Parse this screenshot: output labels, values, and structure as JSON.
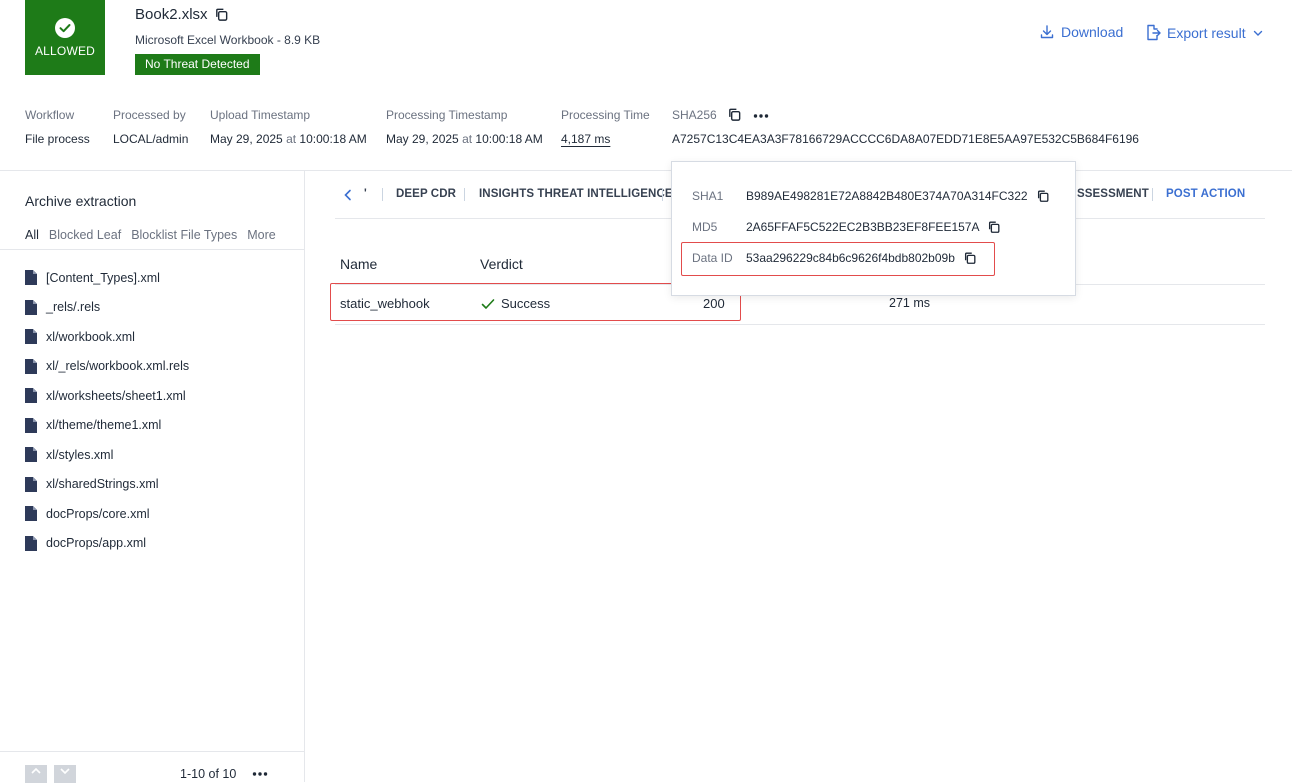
{
  "header": {
    "status_label": "ALLOWED",
    "file_name": "Book2.xlsx",
    "file_subtitle": "Microsoft Excel Workbook - 8.9 KB",
    "threat_badge": "No Threat Detected",
    "download_label": "Download",
    "export_label": "Export result",
    "accent_color": "#1e7b18",
    "link_color": "#3b6fd1"
  },
  "meta": {
    "workflow_label": "Workflow",
    "workflow_value": "File process",
    "processed_by_label": "Processed by",
    "processed_by_value": "LOCAL/admin",
    "upload_label": "Upload Timestamp",
    "upload_date": "May 29, 2025",
    "upload_at": "at",
    "upload_time": "10:00:18 AM",
    "processing_ts_label": "Processing Timestamp",
    "processing_date": "May 29, 2025",
    "processing_at": "at",
    "processing_time_of_day": "10:00:18 AM",
    "processing_time_label": "Processing Time",
    "processing_time_value": "4,187 ms",
    "sha256_label": "SHA256",
    "sha256_value": "A7257C13C4EA3A3F78166729ACCCC6DA8A07EDD71E8E5AA97E532C5B684F6196"
  },
  "sidebar": {
    "title": "Archive extraction",
    "tabs": [
      "All",
      "Blocked Leaf",
      "Blocklist File Types",
      "More"
    ],
    "files": [
      "[Content_Types].xml",
      "_rels/.rels",
      "xl/workbook.xml",
      "xl/_rels/workbook.xml.rels",
      "xl/worksheets/sheet1.xml",
      "xl/theme/theme1.xml",
      "xl/styles.xml",
      "xl/sharedStrings.xml",
      "docProps/core.xml",
      "docProps/app.xml"
    ],
    "pagination": "1-10 of 10"
  },
  "tabs": {
    "prev_indicator": "'",
    "deep_cdr": "DEEP CDR",
    "insights": "INSIGHTS THREAT INTELLIGENCE",
    "assessment_partial": "SSESSMENT",
    "post_action": "POST ACTION"
  },
  "table": {
    "headers": [
      "Name",
      "Verdict"
    ],
    "rows": [
      {
        "name": "static_webhook",
        "verdict": "Success",
        "code": "200",
        "duration": "271 ms"
      }
    ]
  },
  "popover": {
    "sha1_label": "SHA1",
    "sha1_value": "B989AE498281E72A8842B480E374A70A314FC322",
    "md5_label": "MD5",
    "md5_value": "2A65FFAF5C522EC2B3BB23EF8FEE157A",
    "dataid_label": "Data ID",
    "dataid_value": "53aa296229c84b6c9626f4bdb802b09b"
  }
}
